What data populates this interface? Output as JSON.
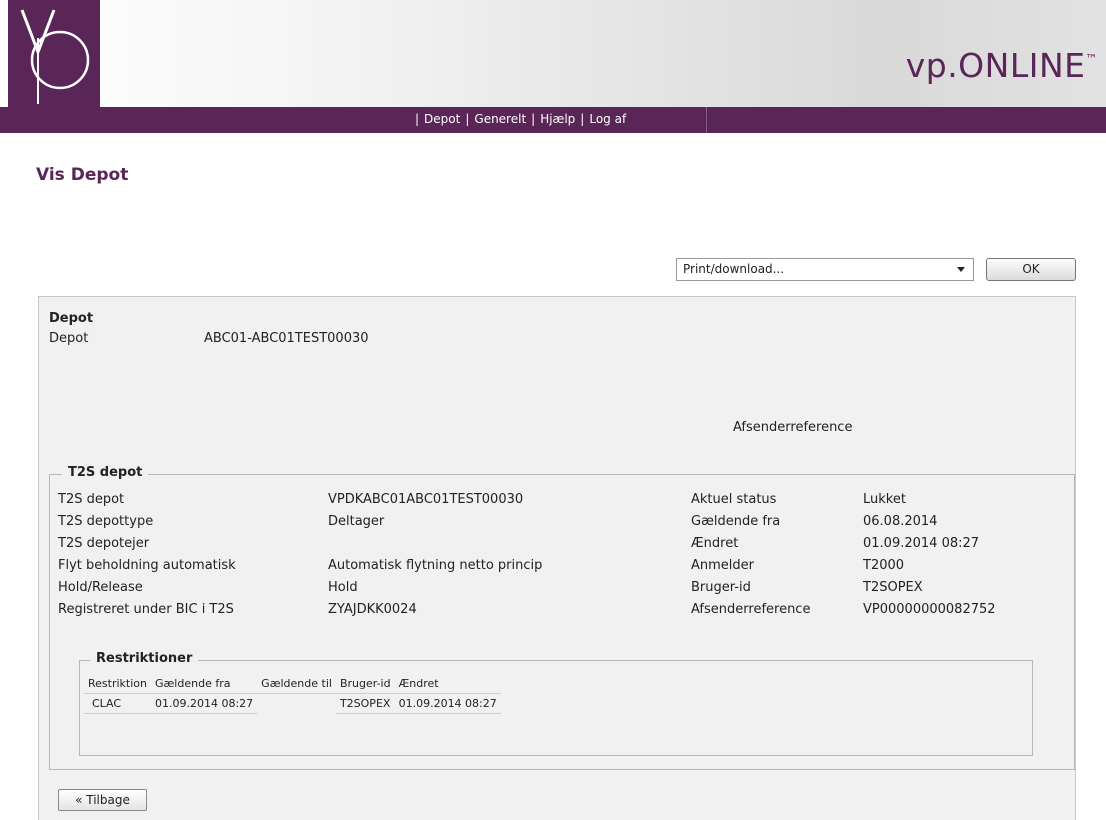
{
  "header": {
    "brand": "vp.ONLINE",
    "brand_mark": "™"
  },
  "nav": {
    "items": [
      "Depot",
      "Generelt",
      "Hjælp",
      "Log af"
    ]
  },
  "page": {
    "title": "Vis Depot"
  },
  "actions": {
    "print_select_value": "Print/download...",
    "ok_label": "OK",
    "back_label": "« Tilbage"
  },
  "depot": {
    "section_title": "Depot",
    "label": "Depot",
    "value": "ABC01-ABC01TEST00030",
    "afsenderreference_label": "Afsenderreference"
  },
  "t2s": {
    "legend": "T2S depot",
    "left_rows": [
      {
        "label": "T2S depot",
        "value": "VPDKABC01ABC01TEST00030"
      },
      {
        "label": "T2S depottype",
        "value": "Deltager"
      },
      {
        "label": "T2S depotejer",
        "value": ""
      },
      {
        "label": "Flyt beholdning automatisk",
        "value": "Automatisk flytning netto princip"
      },
      {
        "label": "Hold/Release",
        "value": "Hold"
      },
      {
        "label": "Registreret under BIC i T2S",
        "value": "ZYAJDKK0024"
      }
    ],
    "right_rows": [
      {
        "label": "Aktuel status",
        "value": "Lukket"
      },
      {
        "label": "Gældende fra",
        "value": "06.08.2014"
      },
      {
        "label": "Ændret",
        "value": "01.09.2014 08:27"
      },
      {
        "label": "Anmelder",
        "value": "T2000"
      },
      {
        "label": "Bruger-id",
        "value": "T2SOPEX"
      },
      {
        "label": "Afsenderreference",
        "value": "VP00000000082752"
      }
    ]
  },
  "restrictions": {
    "legend": "Restriktioner",
    "columns": [
      "Restriktion",
      "Gældende fra",
      "Gældende til",
      "Bruger-id",
      "Ændret"
    ],
    "rows": [
      [
        "CLAC",
        "01.09.2014 08:27",
        "",
        "T2SOPEX",
        "01.09.2014 08:27"
      ]
    ]
  }
}
